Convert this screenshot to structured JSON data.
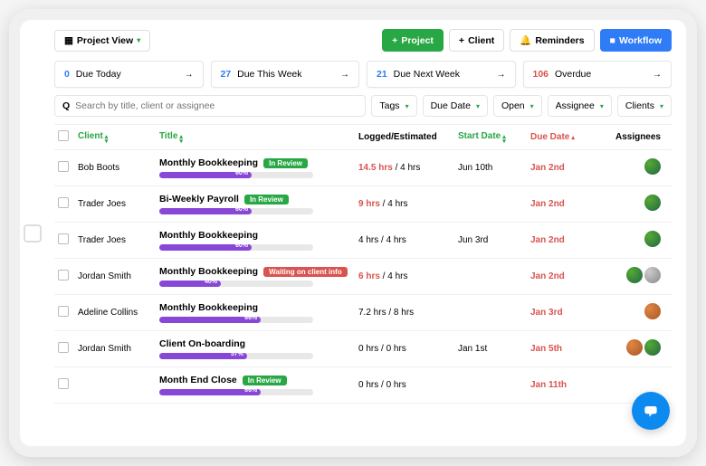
{
  "toolbar": {
    "view_label": "Project View",
    "add_project": "Project",
    "add_client": "Client",
    "reminders": "Reminders",
    "workflow": "Workflow"
  },
  "summary": [
    {
      "count": "0",
      "label": "Due Today"
    },
    {
      "count": "27",
      "label": "Due This Week"
    },
    {
      "count": "21",
      "label": "Due Next Week"
    },
    {
      "count": "106",
      "label": "Overdue",
      "overdue": true
    }
  ],
  "search": {
    "placeholder": "Search by title, client or assignee"
  },
  "filters": {
    "tags": "Tags",
    "due_date": "Due Date",
    "open": "Open",
    "assignee": "Assignee",
    "clients": "Clients"
  },
  "columns": {
    "client": "Client",
    "title": "Title",
    "logged": "Logged/Estimated",
    "start": "Start Date",
    "due": "Due Date",
    "assignees": "Assignees"
  },
  "rows": [
    {
      "client": "Bob Boots",
      "title": "Monthly Bookkeeping",
      "badge": "In Review",
      "badge_class": "badge-green",
      "pct": 60,
      "logged": "14.5 hrs",
      "logged_red": true,
      "est": " / 4 hrs",
      "start": "Jun 10th",
      "due": "Jan 2nd",
      "avatars": [
        "av1"
      ]
    },
    {
      "client": "Trader Joes",
      "title": "Bi-Weekly Payroll",
      "badge": "In Review",
      "badge_class": "badge-green",
      "pct": 60,
      "logged": "9 hrs",
      "logged_red": true,
      "est": " / 4 hrs",
      "start": "",
      "due": "Jan 2nd",
      "avatars": [
        "av1"
      ]
    },
    {
      "client": "Trader Joes",
      "title": "Monthly Bookkeeping",
      "badge": "",
      "badge_class": "",
      "pct": 60,
      "logged": "4 hrs",
      "logged_red": false,
      "est": " / 4 hrs",
      "start": "Jun 3rd",
      "due": "Jan 2nd",
      "avatars": [
        "av1"
      ]
    },
    {
      "client": "Jordan Smith",
      "title": "Monthly Bookkeeping",
      "badge": "Waiting on client info",
      "badge_class": "badge-red",
      "pct": 40,
      "logged": "6 hrs",
      "logged_red": true,
      "est": " / 4 hrs",
      "start": "",
      "due": "Jan 2nd",
      "avatars": [
        "av1",
        "av2"
      ]
    },
    {
      "client": "Adeline Collins",
      "title": "Monthly Bookkeeping",
      "badge": "",
      "badge_class": "",
      "pct": 66,
      "logged": "7.2 hrs",
      "logged_red": false,
      "est": " / 8 hrs",
      "start": "",
      "due": "Jan 3rd",
      "avatars": [
        "av3"
      ]
    },
    {
      "client": "Jordan Smith",
      "title": "Client On-boarding",
      "badge": "",
      "badge_class": "",
      "pct": 57,
      "logged": "0 hrs",
      "logged_red": false,
      "est": " / 0 hrs",
      "start": "Jan 1st",
      "due": "Jan 5th",
      "avatars": [
        "av3",
        "av1"
      ]
    },
    {
      "client": "",
      "title": "Month End Close",
      "badge": "In Review",
      "badge_class": "badge-green",
      "pct": 66,
      "logged": "0 hrs",
      "logged_red": false,
      "est": " / 0 hrs",
      "start": "",
      "due": "Jan 11th",
      "avatars": []
    }
  ]
}
